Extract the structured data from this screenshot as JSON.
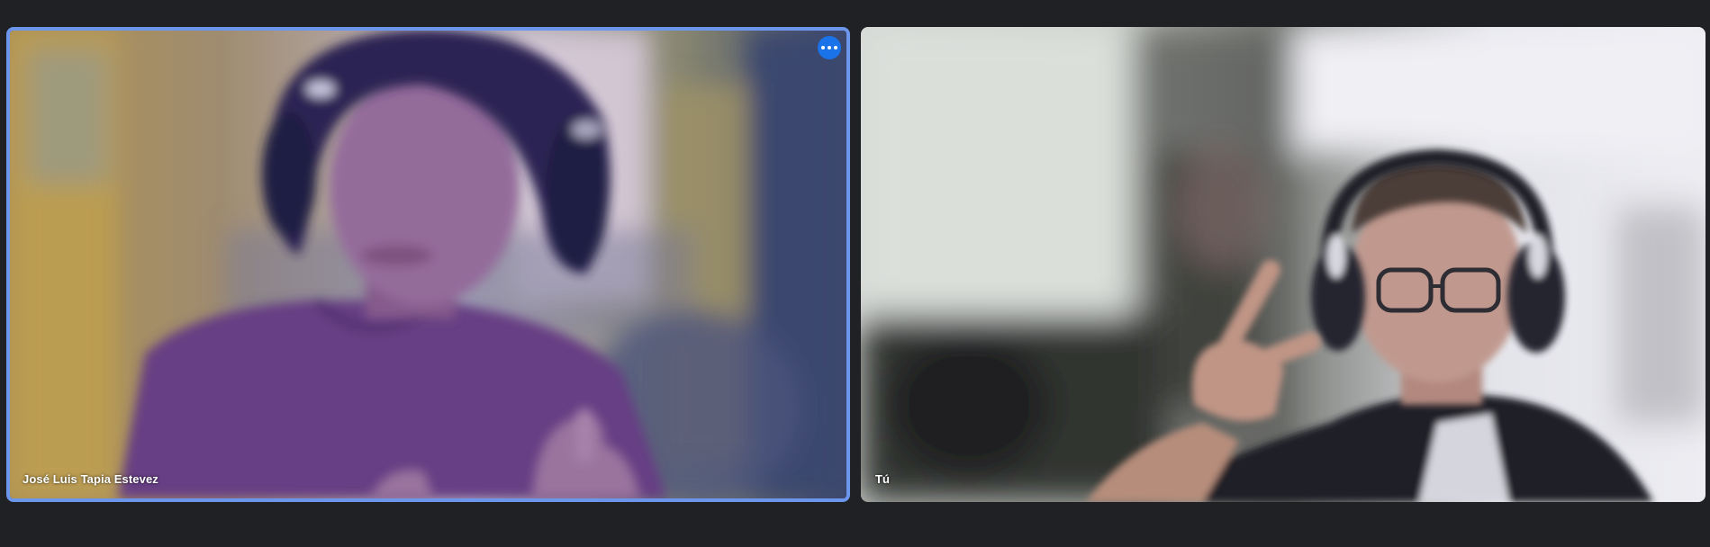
{
  "participants": [
    {
      "name": "José Luis Tapia Estevez",
      "is_self": false,
      "active_speaker": true
    },
    {
      "name": "Tú",
      "is_self": true,
      "active_speaker": false
    }
  ],
  "tile_options": {
    "icon": "more-horizontal-icon"
  },
  "colors": {
    "background": "#202124",
    "active_border": "#6b96ec",
    "options_button": "#1a73e8",
    "label_text": "#ffffff"
  }
}
